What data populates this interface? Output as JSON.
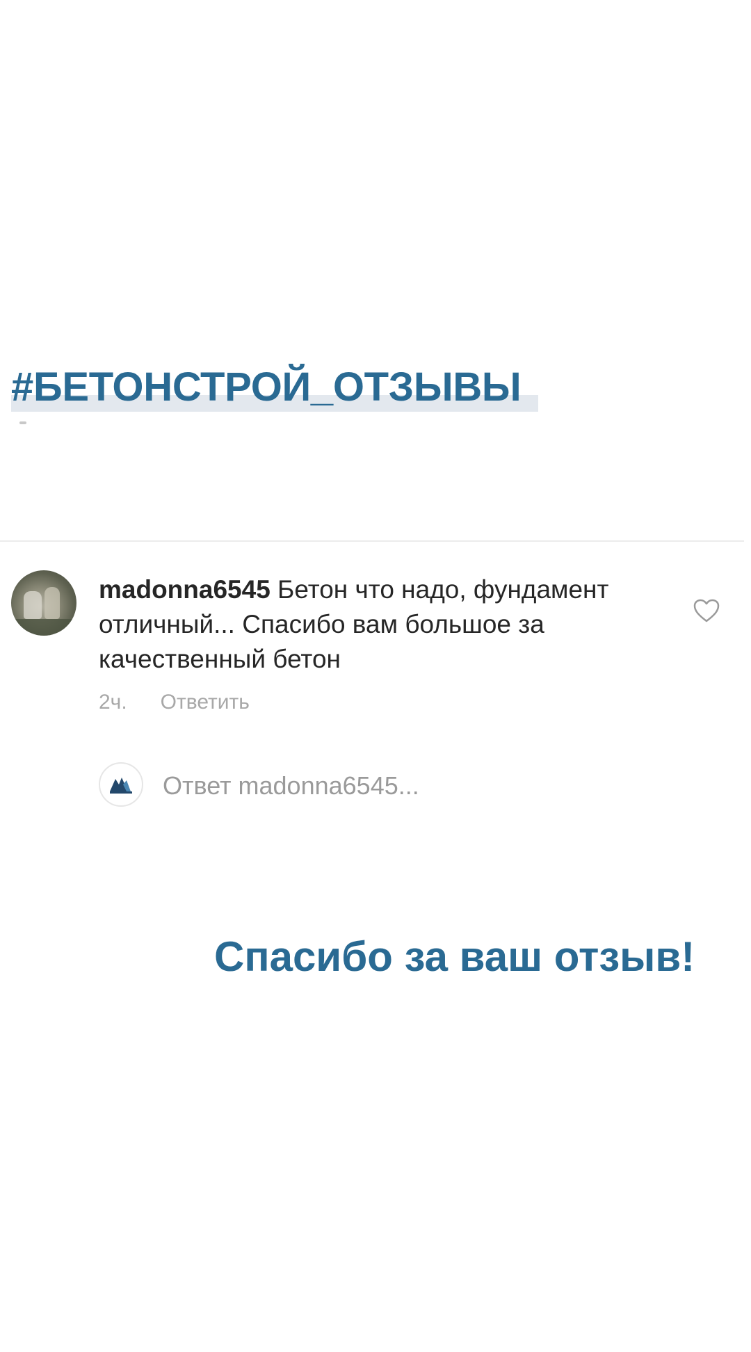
{
  "hashtag": "#БЕТОНСТРОЙ_ОТЗЫВЫ",
  "comment": {
    "username": "madonna6545",
    "text": " Бетон что надо, фундамент отличный... Спасибо вам большое за качественный бетон",
    "time": "2ч.",
    "reply_label": "Ответить",
    "like_icon": "heart-outline-icon"
  },
  "reply_field": {
    "placeholder": "Ответ madonna6545..."
  },
  "thanks_text": "Спасибо за ваш отзыв!",
  "colors": {
    "accent": "#2a6a93",
    "muted": "#a8a8a8",
    "text": "#262626"
  }
}
